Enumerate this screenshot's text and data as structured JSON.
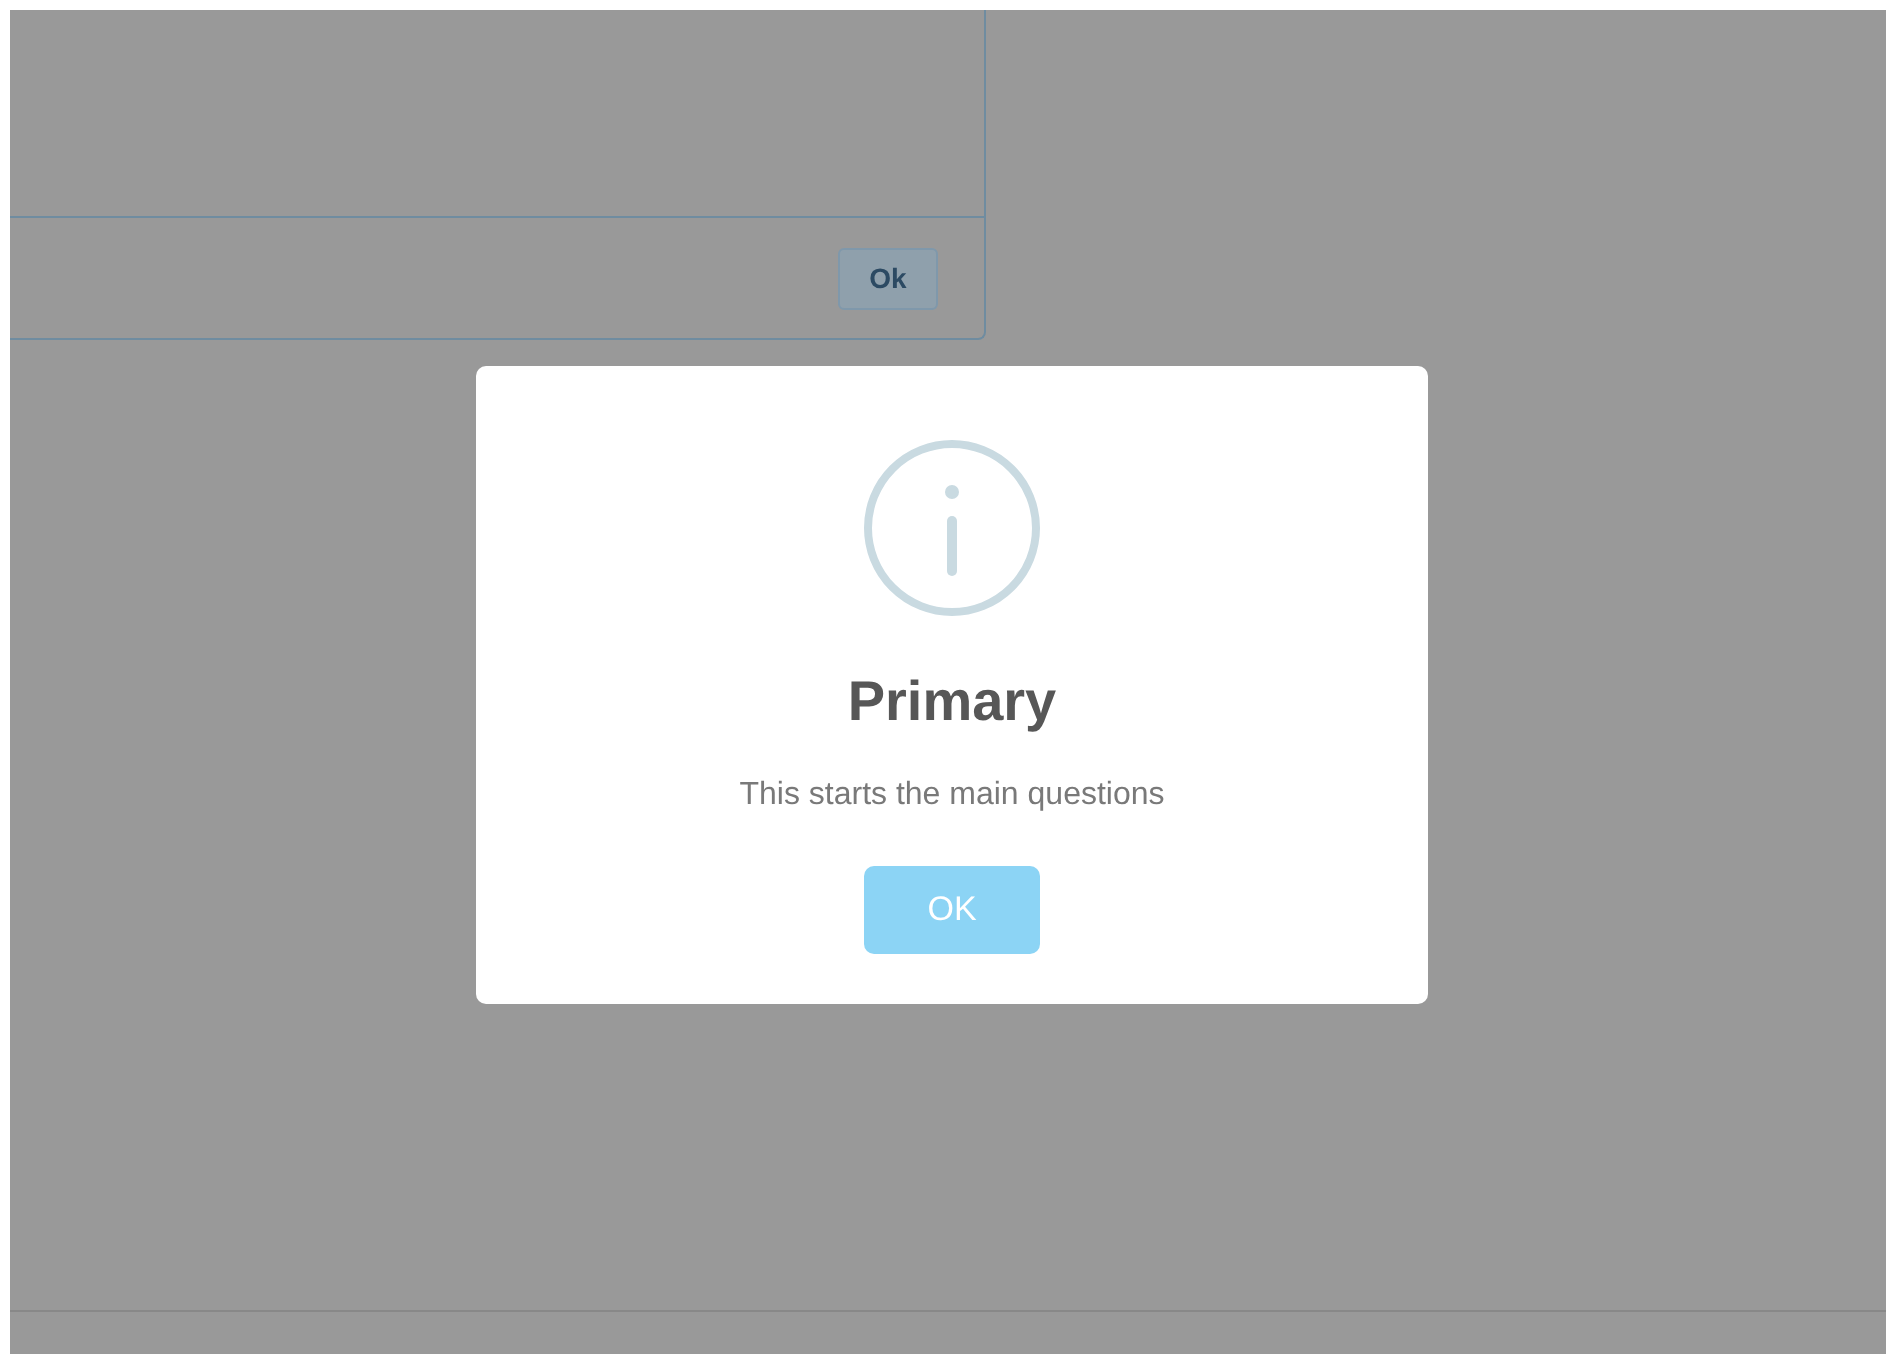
{
  "background_dialog": {
    "button": "Ok"
  },
  "alert": {
    "kind": "info",
    "title": "Primary",
    "message": "This starts the main questions",
    "button": "OK"
  }
}
